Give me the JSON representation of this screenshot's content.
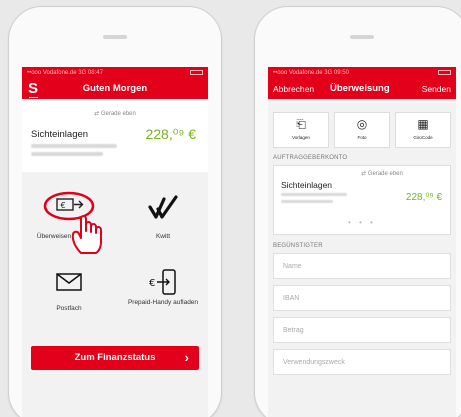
{
  "left_phone": {
    "status": {
      "carrier": "••ooo Vodafone.de  3G  08:47"
    },
    "nav": {
      "logo": "S",
      "title": "Guten Morgen"
    },
    "account": {
      "updated": "⇄ Gerade eben",
      "name": "Sichteinlagen",
      "amount": "228,⁰⁹ €"
    },
    "tiles": [
      {
        "label": "Überweisen",
        "icon": "transfer-icon"
      },
      {
        "label": "Kwitt",
        "icon": "kwitt-icon"
      },
      {
        "label": "Postfach",
        "icon": "mail-icon"
      },
      {
        "label": "Prepaid-Handy aufladen",
        "icon": "phone-topup-icon"
      }
    ],
    "cta": {
      "label": "Zum Finanzstatus",
      "chevron": "›"
    },
    "colors": {
      "brand": "#e2001a",
      "amount": "#7ab21e"
    }
  },
  "right_phone": {
    "status": {
      "carrier": "••ooo Vodafone.de  3G  09:50"
    },
    "nav": {
      "cancel": "Abbrechen",
      "title": "Überweisung",
      "send": "Senden"
    },
    "sources": [
      {
        "label": "Vorlagen",
        "icon": "template-icon",
        "glyph": "⎗"
      },
      {
        "label": "Foto",
        "icon": "camera-icon",
        "glyph": "◎"
      },
      {
        "label": "GiroCode",
        "icon": "qr-code-icon",
        "glyph": "▦"
      }
    ],
    "sender_section": "AUFTRAGGEBERKONTO",
    "sender": {
      "updated": "⇄ Gerade eben",
      "name": "Sichteinlagen",
      "amount": "228,⁰⁹ €",
      "dots": "• • •"
    },
    "recipient_section": "BEGÜNSTIGTER",
    "fields": [
      {
        "placeholder": "Name"
      },
      {
        "placeholder": "IBAN"
      },
      {
        "placeholder": "Betrag"
      },
      {
        "placeholder": "Verwendungszweck"
      }
    ]
  }
}
